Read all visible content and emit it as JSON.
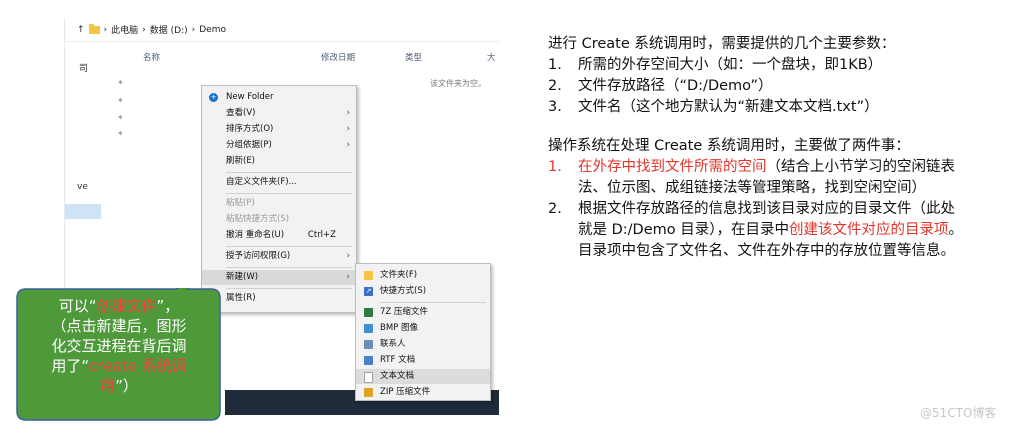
{
  "explorer": {
    "nav_up": "↑",
    "breadcrumb": [
      "此电脑",
      "数据 (D:)",
      "Demo"
    ],
    "sep": "›",
    "cols": [
      "名称",
      "修改日期",
      "类型",
      "大"
    ],
    "empty": "该文件夹为空。",
    "side_a": "司",
    "side_b": "ve"
  },
  "menu": {
    "items": [
      {
        "label": "New Folder",
        "arrow": ""
      },
      {
        "label": "查看(V)",
        "arrow": "›"
      },
      {
        "label": "排序方式(O)",
        "arrow": "›"
      },
      {
        "label": "分组依据(P)",
        "arrow": "›"
      },
      {
        "label": "刷新(E)",
        "arrow": ""
      },
      {
        "label": "自定义文件夹(F)...",
        "arrow": ""
      },
      {
        "label": "粘贴(P)",
        "arrow": ""
      },
      {
        "label": "粘贴快捷方式(S)",
        "arrow": ""
      },
      {
        "label": "撤消 重命名(U)",
        "arrow": ""
      },
      {
        "label": "授予访问权限(G)",
        "arrow": "›"
      },
      {
        "label": "新建(W)",
        "arrow": "›"
      },
      {
        "label": "属性(R)",
        "arrow": ""
      }
    ],
    "undo_shortcut": "Ctrl+Z"
  },
  "submenu": {
    "items": [
      {
        "label": "文件夹(F)",
        "icon": "folder-icon",
        "color": "#f4c542"
      },
      {
        "label": "快捷方式(S)",
        "icon": "shortcut-icon",
        "color": "#3a6fc4"
      },
      {
        "label": "7Z 压缩文件",
        "icon": "archive-7z-icon",
        "color": "#2f7a3f"
      },
      {
        "label": "BMP 图像",
        "icon": "image-icon",
        "color": "#3a8fd6"
      },
      {
        "label": "联系人",
        "icon": "contact-icon",
        "color": "#6a8fb5"
      },
      {
        "label": "RTF 文档",
        "icon": "rtf-doc-icon",
        "color": "#4a7fc9"
      },
      {
        "label": "文本文档",
        "icon": "text-doc-icon",
        "color": "#9aa4b0"
      },
      {
        "label": "ZIP 压缩文件",
        "icon": "zip-icon",
        "color": "#e0a020"
      }
    ]
  },
  "callout": {
    "l1a": "可以“",
    "l1b": "创建文件",
    "l1c": "”，",
    "l2": "（点击新建后，图形",
    "l3": "化交互进程在背后调",
    "l4a": "用了“",
    "l4b": "create 系统调",
    "l5a": "用",
    "l5b": "”）",
    "color_fill": "#4e9a3a",
    "color_border": "#3a5f9e"
  },
  "notes": {
    "intro": "进行 Create 系统调用时，需要提供的几个主要参数：",
    "params": [
      {
        "n": "1.",
        "t": "所需的外存空间大小（如：一个盘块，即1KB）"
      },
      {
        "n": "2.",
        "t": "文件存放路径（“D:/Demo”）"
      },
      {
        "n": "3.",
        "t": "文件名（这个地方默认为“新建文本文档.txt”）"
      }
    ],
    "p2": "操作系统在处理 Create 系统调用时，主要做了两件事：",
    "s1_n": "1.",
    "s1_red": "在外存中找到文件所需的空间",
    "s1_rest": "（结合上小节学习的空闲链表法、位示图、成组链接法等管理策略，找到空闲空间）",
    "s2_n": "2.",
    "s2_a": "根据文件存放路径的信息找到该目录对应的目录文件（此处就是 D:/Demo 目录），在目录中",
    "s2_red": "创建该文件对应的目录项",
    "s2_b": "。目录项中包含了文件名、文件在外存中的存放位置等信息。"
  },
  "watermark": "@51CTO博客"
}
